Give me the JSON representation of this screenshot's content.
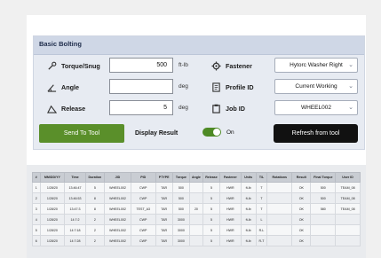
{
  "panel": {
    "title": "Basic Bolting"
  },
  "fields": {
    "torque": {
      "label": "Torque/Snug",
      "value": "500",
      "unit": "ft-lb"
    },
    "angle": {
      "label": "Angle",
      "value": "",
      "unit": "deg"
    },
    "release": {
      "label": "Release",
      "value": "5",
      "unit": "deg"
    }
  },
  "selectors": {
    "fastener": {
      "label": "Fastener",
      "value": "Hytorc Washer Right"
    },
    "profile": {
      "label": "Profile ID",
      "value": "Current Working"
    },
    "job": {
      "label": "Job ID",
      "value": "WHEEL002"
    }
  },
  "actions": {
    "send": "Send To Tool",
    "display_result": "Display Result",
    "toggle_state": "On",
    "refresh": "Refresh from tool"
  },
  "table": {
    "columns": [
      "#",
      "MM/DD/YY",
      "Time",
      "Duration",
      "JID",
      "PID",
      "PTYPE",
      "Torque",
      "Angle",
      "Release",
      "Fastener",
      "Units",
      "T/L",
      "Rotations",
      "Result",
      "Final Torque",
      "User ID"
    ],
    "rows": [
      [
        "1",
        "1/28/20",
        "13:46:47",
        "5",
        "WHEEL002",
        "CWP",
        "TAR",
        "500",
        "",
        "5",
        "HWR",
        "ft-lb",
        "T",
        "",
        "OK",
        "500",
        "TEAM_08"
      ],
      [
        "2",
        "1/28/20",
        "13:46:53",
        "8",
        "WHEEL002",
        "CWP",
        "TAR",
        "500",
        "",
        "5",
        "HWR",
        "ft-lb",
        "T",
        "",
        "OK",
        "500",
        "TEAM_08"
      ],
      [
        "3",
        "1/28/20",
        "13:47:3",
        "8",
        "WHEEL002",
        "TEST_A3",
        "TAR",
        "500",
        "20",
        "5",
        "HWR",
        "ft-lb",
        "T",
        "",
        "OK",
        "580",
        "TEAM_08"
      ],
      [
        "4",
        "1/28/20",
        "14:7:2",
        "2",
        "WHEEL002",
        "CWP",
        "TAR",
        "3000",
        "",
        "5",
        "HWR",
        "ft-lb",
        "L",
        "",
        "OK",
        "",
        ""
      ],
      [
        "5",
        "1/28/20",
        "14:7:18",
        "2",
        "WHEEL002",
        "CWP",
        "TAR",
        "3000",
        "",
        "5",
        "HWR",
        "ft-lb",
        "R-L",
        "",
        "OK",
        "",
        ""
      ],
      [
        "6",
        "1/28/20",
        "14:7:28",
        "2",
        "WHEEL002",
        "CWP",
        "TAR",
        "3000",
        "",
        "5",
        "HWR",
        "ft-lb",
        "R-T",
        "",
        "OK",
        "",
        ""
      ]
    ]
  }
}
